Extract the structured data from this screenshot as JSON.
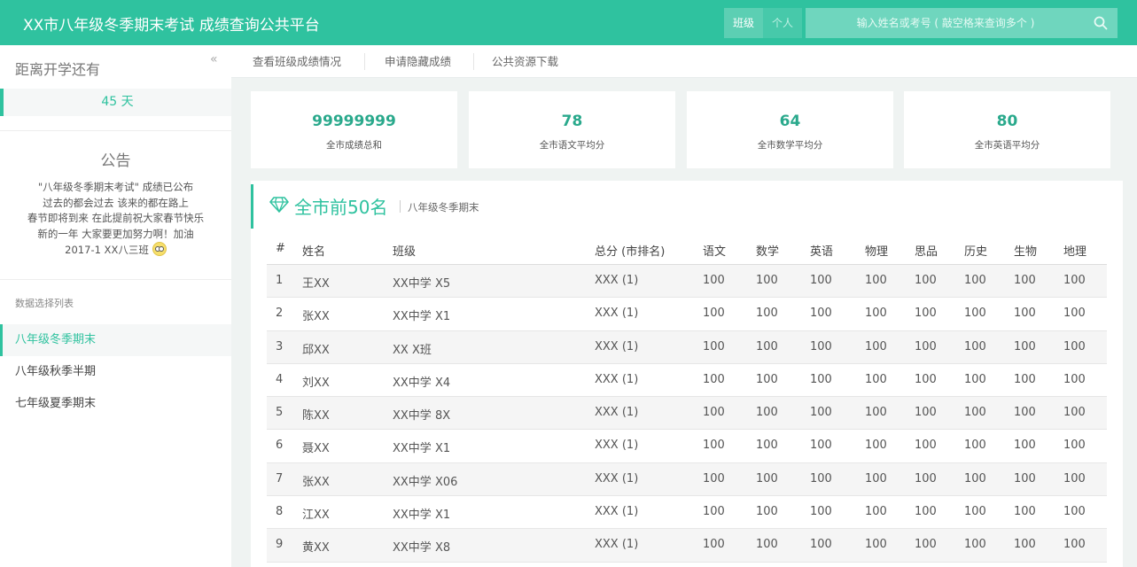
{
  "header": {
    "title": "XX市八年级冬季期末考试 成绩查询公共平台",
    "scope_class": "班级",
    "scope_person": "个人",
    "search_placeholder": "输入姓名或考号 ( 敲空格来查询多个 )"
  },
  "sidebar": {
    "collapse_glyph": "«",
    "countdown_label": "距离开学还有",
    "countdown_value": "45 天",
    "notice_title": "公告",
    "notice_lines": [
      "\"八年级冬季期末考试\" 成绩已公布",
      "过去的都会过去 该来的都在路上",
      "春节即将到来 在此提前祝大家春节快乐",
      "新的一年 大家要更加努力啊！加油",
      "2017-1 XX八三班"
    ],
    "list_heading": "数据选择列表",
    "datasets": [
      "八年级冬季期末",
      "八年级秋季半期",
      "七年级夏季期末"
    ]
  },
  "subnav": [
    "查看班级成绩情况",
    "申请隐藏成绩",
    "公共资源下载"
  ],
  "stats": [
    {
      "value": "99999999",
      "label": "全市成绩总和"
    },
    {
      "value": "78",
      "label": "全市语文平均分"
    },
    {
      "value": "64",
      "label": "全市数学平均分"
    },
    {
      "value": "80",
      "label": "全市英语平均分"
    }
  ],
  "ranking": {
    "title": "全市前50名",
    "subtitle": "八年级冬季期末",
    "columns": [
      "#",
      "姓名",
      "班级",
      "总分 (市排名)",
      "语文",
      "数学",
      "英语",
      "物理",
      "思品",
      "历史",
      "生物",
      "地理"
    ],
    "rows": [
      [
        "1",
        "王XX",
        "XX中学 X5",
        "XXX (1)",
        "100",
        "100",
        "100",
        "100",
        "100",
        "100",
        "100",
        "100"
      ],
      [
        "2",
        "张XX",
        "XX中学 X1",
        "XXX (1)",
        "100",
        "100",
        "100",
        "100",
        "100",
        "100",
        "100",
        "100"
      ],
      [
        "3",
        "邱XX",
        "XX X班",
        "XXX (1)",
        "100",
        "100",
        "100",
        "100",
        "100",
        "100",
        "100",
        "100"
      ],
      [
        "4",
        "刘XX",
        "XX中学 X4",
        "XXX (1)",
        "100",
        "100",
        "100",
        "100",
        "100",
        "100",
        "100",
        "100"
      ],
      [
        "5",
        "陈XX",
        "XX中学 8X",
        "XXX (1)",
        "100",
        "100",
        "100",
        "100",
        "100",
        "100",
        "100",
        "100"
      ],
      [
        "6",
        "聂XX",
        "XX中学 X1",
        "XXX (1)",
        "100",
        "100",
        "100",
        "100",
        "100",
        "100",
        "100",
        "100"
      ],
      [
        "7",
        "张XX",
        "XX中学 X06",
        "XXX (1)",
        "100",
        "100",
        "100",
        "100",
        "100",
        "100",
        "100",
        "100"
      ],
      [
        "8",
        "江XX",
        "XX中学 X1",
        "XXX (1)",
        "100",
        "100",
        "100",
        "100",
        "100",
        "100",
        "100",
        "100"
      ],
      [
        "9",
        "黄XX",
        "XX中学 X8",
        "XXX (1)",
        "100",
        "100",
        "100",
        "100",
        "100",
        "100",
        "100",
        "100"
      ]
    ]
  },
  "colors": {
    "accent": "#2fc29f",
    "accent_dark": "#2aa98c"
  }
}
